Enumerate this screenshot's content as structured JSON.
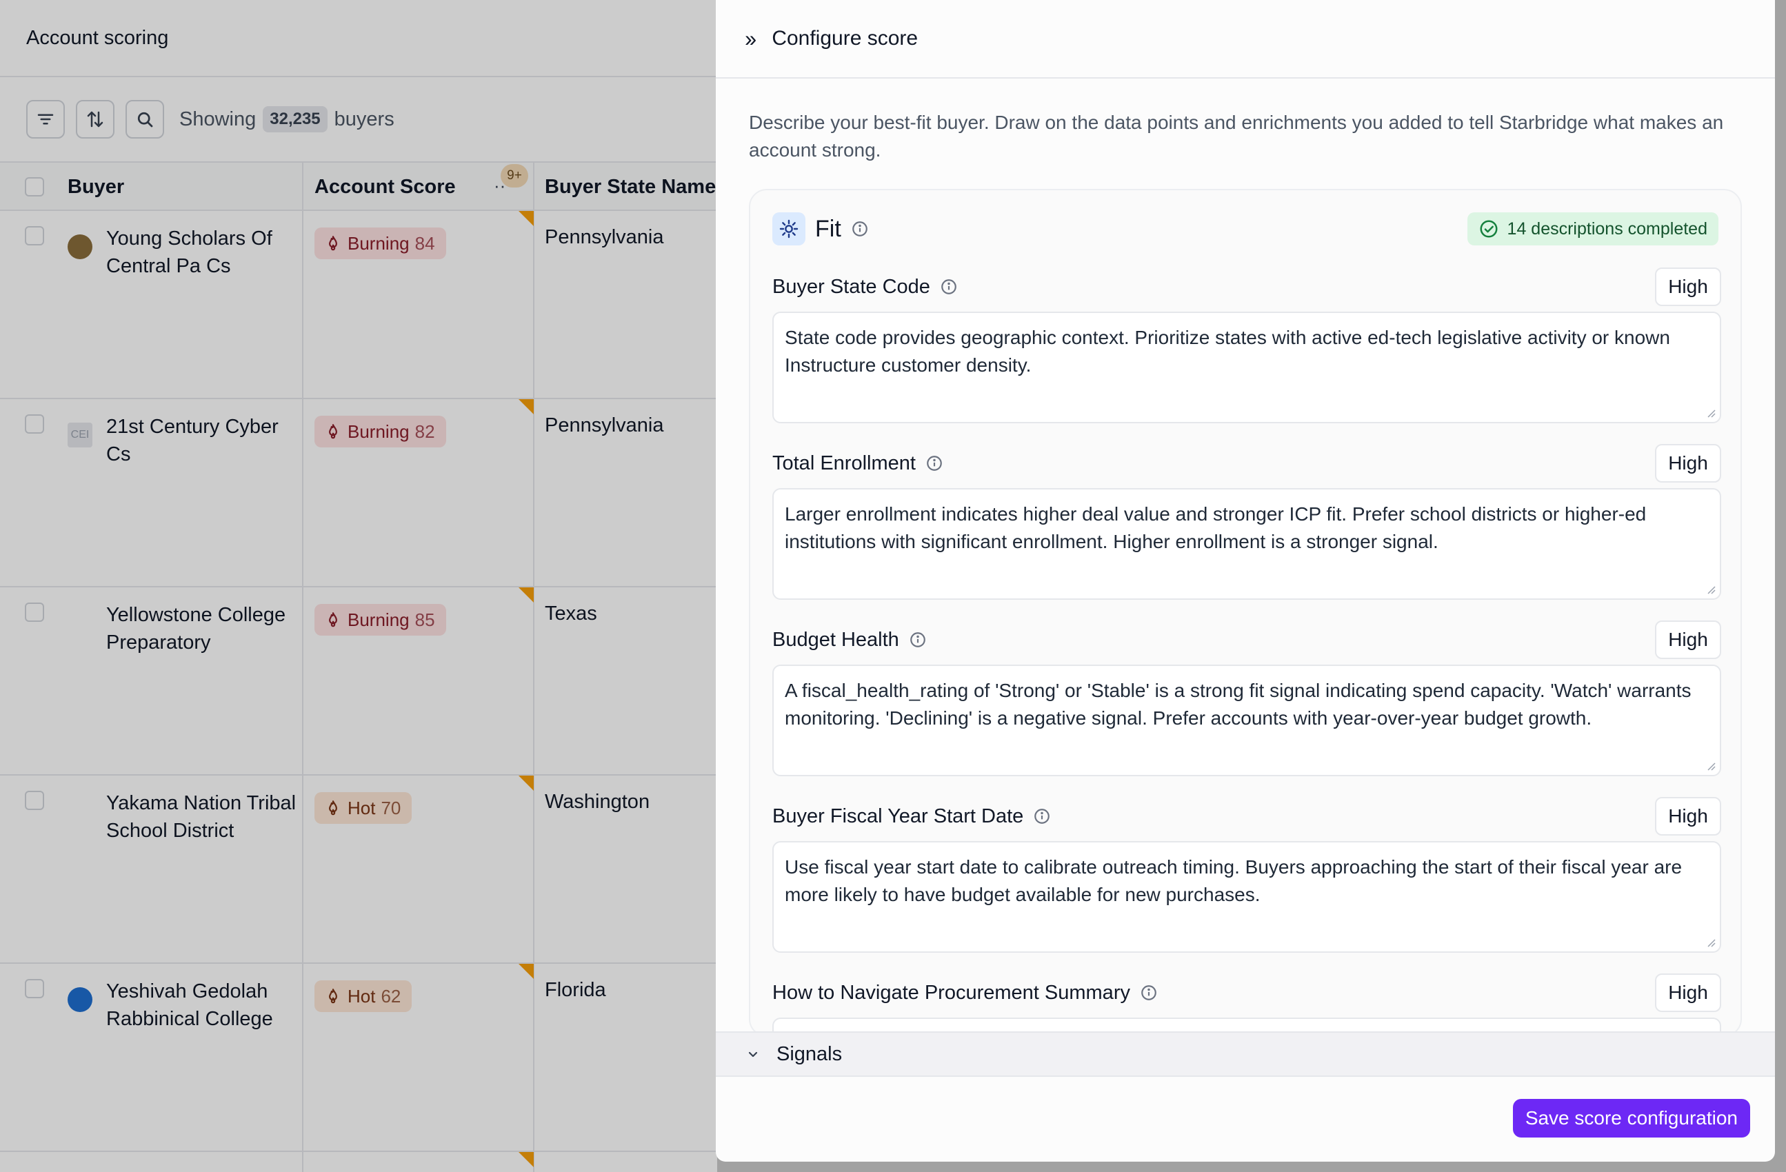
{
  "table": {
    "title": "Account scoring",
    "showing_prefix": "Showing",
    "count": "32,235",
    "showing_suffix": "buyers",
    "columns": {
      "buyer": "Buyer",
      "score": "Account Score",
      "state": "Buyer State Name"
    },
    "more_badge": "9+",
    "more_dots": "··",
    "rows": [
      {
        "name": "Young Scholars Of Central Pa Cs",
        "tier": "Burning",
        "score": "84",
        "state": "Pennsylvania",
        "logo_color": "#8a6d3b",
        "logo_text": ""
      },
      {
        "name": "21st Century Cyber Cs",
        "tier": "Burning",
        "score": "82",
        "state": "Pennsylvania",
        "logo_color": "#e5e7eb",
        "logo_text": "CEI"
      },
      {
        "name": "Yellowstone College Preparatory",
        "tier": "Burning",
        "score": "85",
        "state": "Texas",
        "logo_color": "#ffffff",
        "logo_text": ""
      },
      {
        "name": "Yakama Nation Tribal School District",
        "tier": "Hot",
        "score": "70",
        "state": "Washington",
        "logo_color": "#ffffff",
        "logo_text": ""
      },
      {
        "name": "Yeshivah Gedolah Rabbinical College",
        "tier": "Hot",
        "score": "62",
        "state": "Florida",
        "logo_color": "#1e6fd0",
        "logo_text": ""
      }
    ]
  },
  "panel": {
    "title": "Configure score",
    "description": "Describe your best-fit buyer. Draw on the data points and enrichments you added to tell Starbridge what makes an account strong.",
    "fit": {
      "title": "Fit",
      "completed": "14 descriptions completed",
      "fields": [
        {
          "label": "Buyer State Code",
          "weight": "High",
          "text": "State code provides geographic context. Prioritize states with active ed-tech legislative activity or known Instructure customer density."
        },
        {
          "label": "Total Enrollment",
          "weight": "High",
          "text": "Larger enrollment indicates higher deal value and stronger ICP fit. Prefer school districts or higher-ed institutions with significant enrollment. Higher enrollment is a stronger signal."
        },
        {
          "label": "Budget Health",
          "weight": "High",
          "text": "A fiscal_health_rating of 'Strong' or 'Stable' is a strong fit signal indicating spend capacity. 'Watch' warrants monitoring. 'Declining' is a negative signal. Prefer accounts with year-over-year budget growth."
        },
        {
          "label": "Buyer Fiscal Year Start Date",
          "weight": "High",
          "text": "Use fiscal year start date to calibrate outreach timing. Buyers approaching the start of their fiscal year are more likely to have budget available for new purchases."
        },
        {
          "label": "How to Navigate Procurement Summary",
          "weight": "High",
          "text": ""
        }
      ]
    },
    "signals_label": "Signals",
    "save_label": "Save score configuration"
  },
  "colors": {
    "accent": "#6d28f5",
    "burning_bg": "#fde2e2",
    "hot_bg": "#fde6d6",
    "completed_bg": "#dcf5e3",
    "corner_marker": "#f59e0b"
  },
  "icons": {
    "filter": "filter-icon",
    "sort": "sort-icon",
    "search": "search-icon",
    "flame": "flame-icon",
    "info": "info-icon",
    "check": "check-circle-icon",
    "collapse": "chevrons-right-icon",
    "chevron": "chevron-down-icon",
    "fit": "gear-icon"
  }
}
